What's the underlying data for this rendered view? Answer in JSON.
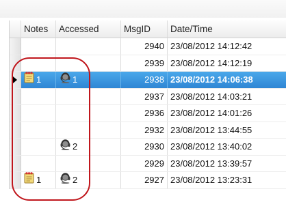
{
  "columns": {
    "notes": "Notes",
    "accessed": "Accessed",
    "msgid": "MsgID",
    "datetime": "Date/Time"
  },
  "rows": [
    {
      "notes": "",
      "accessed": "",
      "msgid": "2940",
      "datetime": "23/08/2012 14:12:42"
    },
    {
      "notes": "",
      "accessed": "",
      "msgid": "2939",
      "datetime": "23/08/2012 14:12:19"
    },
    {
      "notes": "1",
      "accessed": "1",
      "msgid": "2938",
      "datetime": "23/08/2012 14:06:38",
      "selected": true
    },
    {
      "notes": "",
      "accessed": "",
      "msgid": "2937",
      "datetime": "23/08/2012 14:03:21"
    },
    {
      "notes": "",
      "accessed": "",
      "msgid": "2936",
      "datetime": "23/08/2012 14:01:26"
    },
    {
      "notes": "",
      "accessed": "",
      "msgid": "2932",
      "datetime": "23/08/2012 13:44:55"
    },
    {
      "notes": "",
      "accessed": "2",
      "msgid": "2930",
      "datetime": "23/08/2012 13:40:02"
    },
    {
      "notes": "",
      "accessed": "",
      "msgid": "2929",
      "datetime": "23/08/2012 13:39:57"
    },
    {
      "notes": "1",
      "accessed": "2",
      "msgid": "2927",
      "datetime": "23/08/2012 13:23:31"
    }
  ],
  "icons": {
    "notes": "notepad-icon",
    "accessed": "user-headset-icon",
    "row_pointer": "row-pointer-icon"
  },
  "colors": {
    "selection": "#2f86d4",
    "annotation": "#c0161c"
  }
}
